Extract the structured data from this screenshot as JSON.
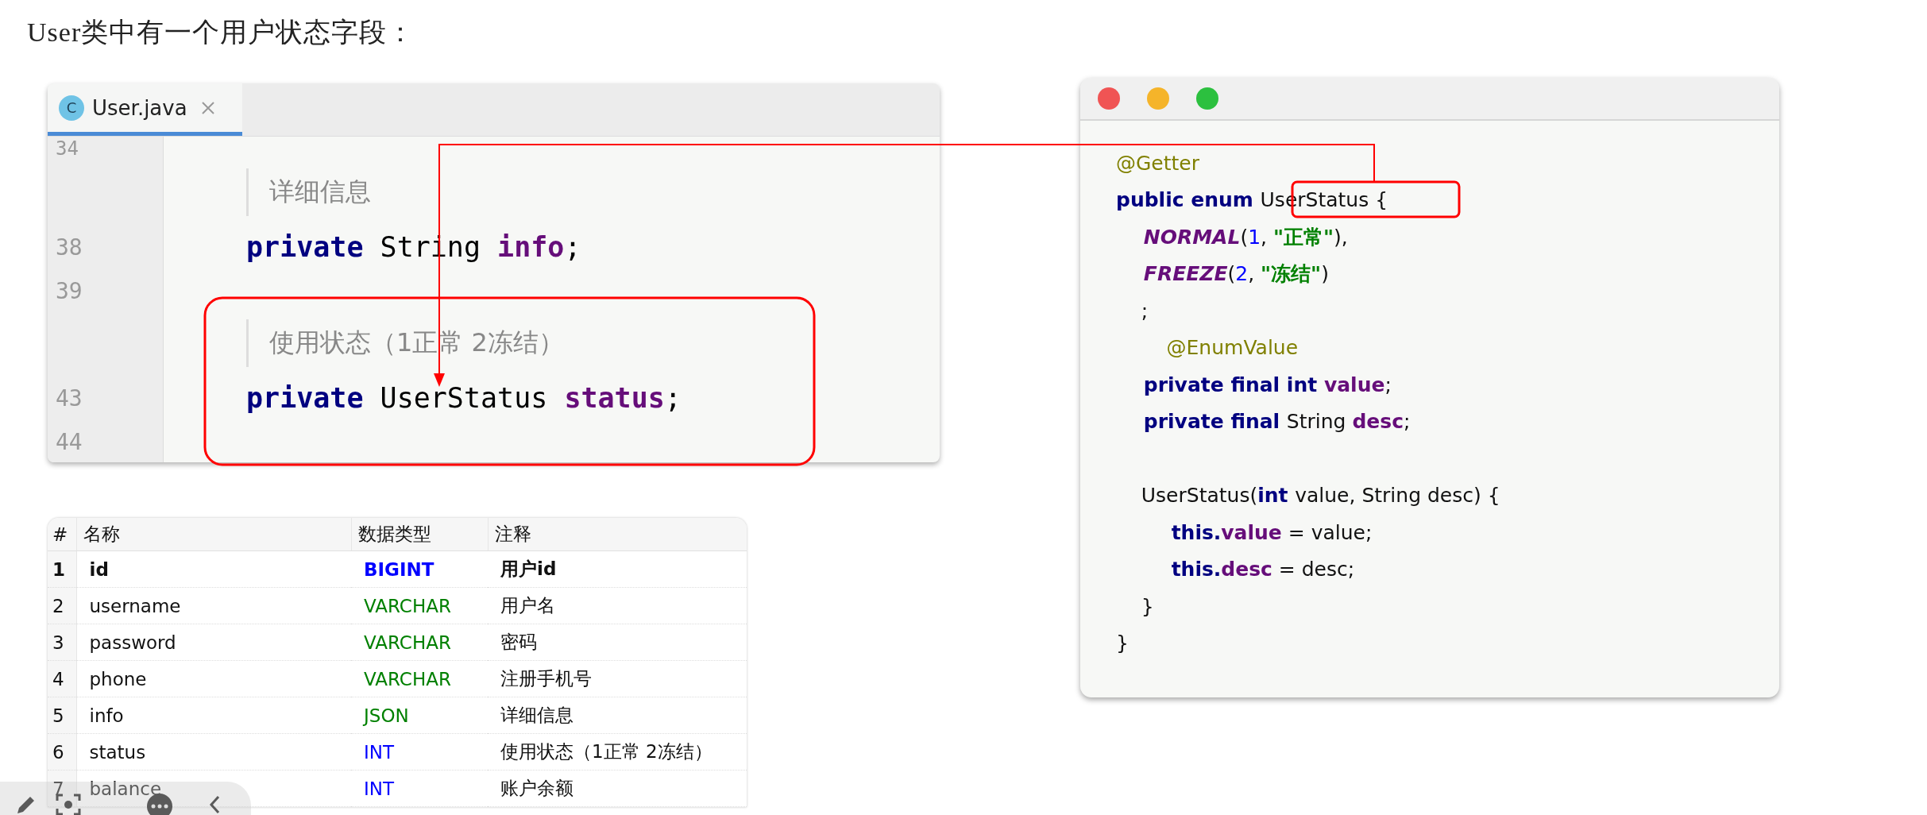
{
  "heading": "User类中有一个用户状态字段：",
  "editor": {
    "tab": {
      "icon_letter": "C",
      "label": "User.java",
      "selected": true
    },
    "lines": [
      {
        "kind": "blank",
        "number": "34"
      },
      {
        "kind": "doc",
        "text": "详细信息"
      },
      {
        "kind": "code",
        "number": "38",
        "tokens": [
          {
            "text": "private ",
            "kind": "keyword"
          },
          {
            "text": "String ",
            "kind": "plain"
          },
          {
            "text": "info",
            "kind": "field"
          },
          {
            "text": ";",
            "kind": "plain"
          }
        ]
      },
      {
        "kind": "blank",
        "number": "39"
      },
      {
        "kind": "doc",
        "text": "使用状态（1正常 2冻结）"
      },
      {
        "kind": "code",
        "number": "43",
        "tokens": [
          {
            "text": "private ",
            "kind": "keyword"
          },
          {
            "text": "UserStatus ",
            "kind": "plain"
          },
          {
            "text": "status",
            "kind": "field"
          },
          {
            "text": ";",
            "kind": "plain"
          }
        ]
      },
      {
        "kind": "blank",
        "number": "44"
      }
    ]
  },
  "table": {
    "columns": [
      "#",
      "名称",
      "数据类型",
      "注释"
    ],
    "rows": [
      {
        "index": "1",
        "name": "id",
        "type": "BIGINT",
        "color": "#0000ff",
        "comment": "用户id",
        "bold": true
      },
      {
        "index": "2",
        "name": "username",
        "type": "VARCHAR",
        "color": "#008000",
        "comment": "用户名",
        "bold": false
      },
      {
        "index": "3",
        "name": "password",
        "type": "VARCHAR",
        "color": "#008000",
        "comment": "密码",
        "bold": false
      },
      {
        "index": "4",
        "name": "phone",
        "type": "VARCHAR",
        "color": "#008000",
        "comment": "注册手机号",
        "bold": false
      },
      {
        "index": "5",
        "name": "info",
        "type": "JSON",
        "color": "#008000",
        "comment": "详细信息",
        "bold": false
      },
      {
        "index": "6",
        "name": "status",
        "type": "INT",
        "color": "#0000ff",
        "comment": "使用状态（1正常 2冻结）",
        "bold": false
      },
      {
        "index": "7",
        "name": "balance",
        "type": "INT",
        "color": "#0000ff",
        "comment": "账户余额",
        "bold": false
      }
    ]
  },
  "code_window": {
    "lines": [
      {
        "kind": "code",
        "tokens": [
          {
            "text": "@Getter",
            "kind": "annotation"
          }
        ]
      },
      {
        "kind": "code",
        "tokens": [
          {
            "text": "public enum ",
            "kind": "keyword"
          },
          {
            "text": "UserStatus {",
            "kind": "plain"
          }
        ]
      },
      {
        "kind": "code",
        "tokens": [
          {
            "text": "    NORMAL",
            "kind": "constant"
          },
          {
            "text": "(",
            "kind": "plain"
          },
          {
            "text": "1",
            "kind": "number"
          },
          {
            "text": ", ",
            "kind": "plain"
          },
          {
            "text": "\"正常\"",
            "kind": "string"
          },
          {
            "text": "),",
            "kind": "plain"
          }
        ]
      },
      {
        "kind": "code",
        "tokens": [
          {
            "text": "    FREEZE",
            "kind": "constant"
          },
          {
            "text": "(",
            "kind": "plain"
          },
          {
            "text": "2",
            "kind": "number"
          },
          {
            "text": ", ",
            "kind": "plain"
          },
          {
            "text": "\"冻结\"",
            "kind": "string"
          },
          {
            "text": ")",
            "kind": "plain"
          }
        ]
      },
      {
        "kind": "code",
        "tokens": [
          {
            "text": "    ;",
            "kind": "plain"
          }
        ]
      },
      {
        "kind": "code",
        "tokens": [
          {
            "text": "        @EnumValue",
            "kind": "annotation"
          }
        ]
      },
      {
        "kind": "code",
        "tokens": [
          {
            "text": "    private final int ",
            "kind": "keyword"
          },
          {
            "text": "value",
            "kind": "field"
          },
          {
            "text": ";",
            "kind": "plain"
          }
        ]
      },
      {
        "kind": "code",
        "tokens": [
          {
            "text": "    private final ",
            "kind": "keyword"
          },
          {
            "text": "String ",
            "kind": "plain"
          },
          {
            "text": "desc",
            "kind": "field"
          },
          {
            "text": ";",
            "kind": "plain"
          }
        ]
      },
      {
        "kind": "blank"
      },
      {
        "kind": "code",
        "tokens": [
          {
            "text": "    UserStatus(",
            "kind": "plain"
          },
          {
            "text": "int ",
            "kind": "keyword"
          },
          {
            "text": "value, String desc) {",
            "kind": "plain"
          }
        ]
      },
      {
        "kind": "code",
        "tokens": [
          {
            "text": "        this.",
            "kind": "keyword"
          },
          {
            "text": "value",
            "kind": "field"
          },
          {
            "text": " = value;",
            "kind": "plain"
          }
        ]
      },
      {
        "kind": "code",
        "tokens": [
          {
            "text": "        this.",
            "kind": "keyword"
          },
          {
            "text": "desc",
            "kind": "field"
          },
          {
            "text": " = desc;",
            "kind": "plain"
          }
        ]
      },
      {
        "kind": "code",
        "tokens": [
          {
            "text": "    }",
            "kind": "plain"
          }
        ]
      },
      {
        "kind": "code",
        "tokens": [
          {
            "text": "}",
            "kind": "plain"
          }
        ]
      }
    ]
  }
}
